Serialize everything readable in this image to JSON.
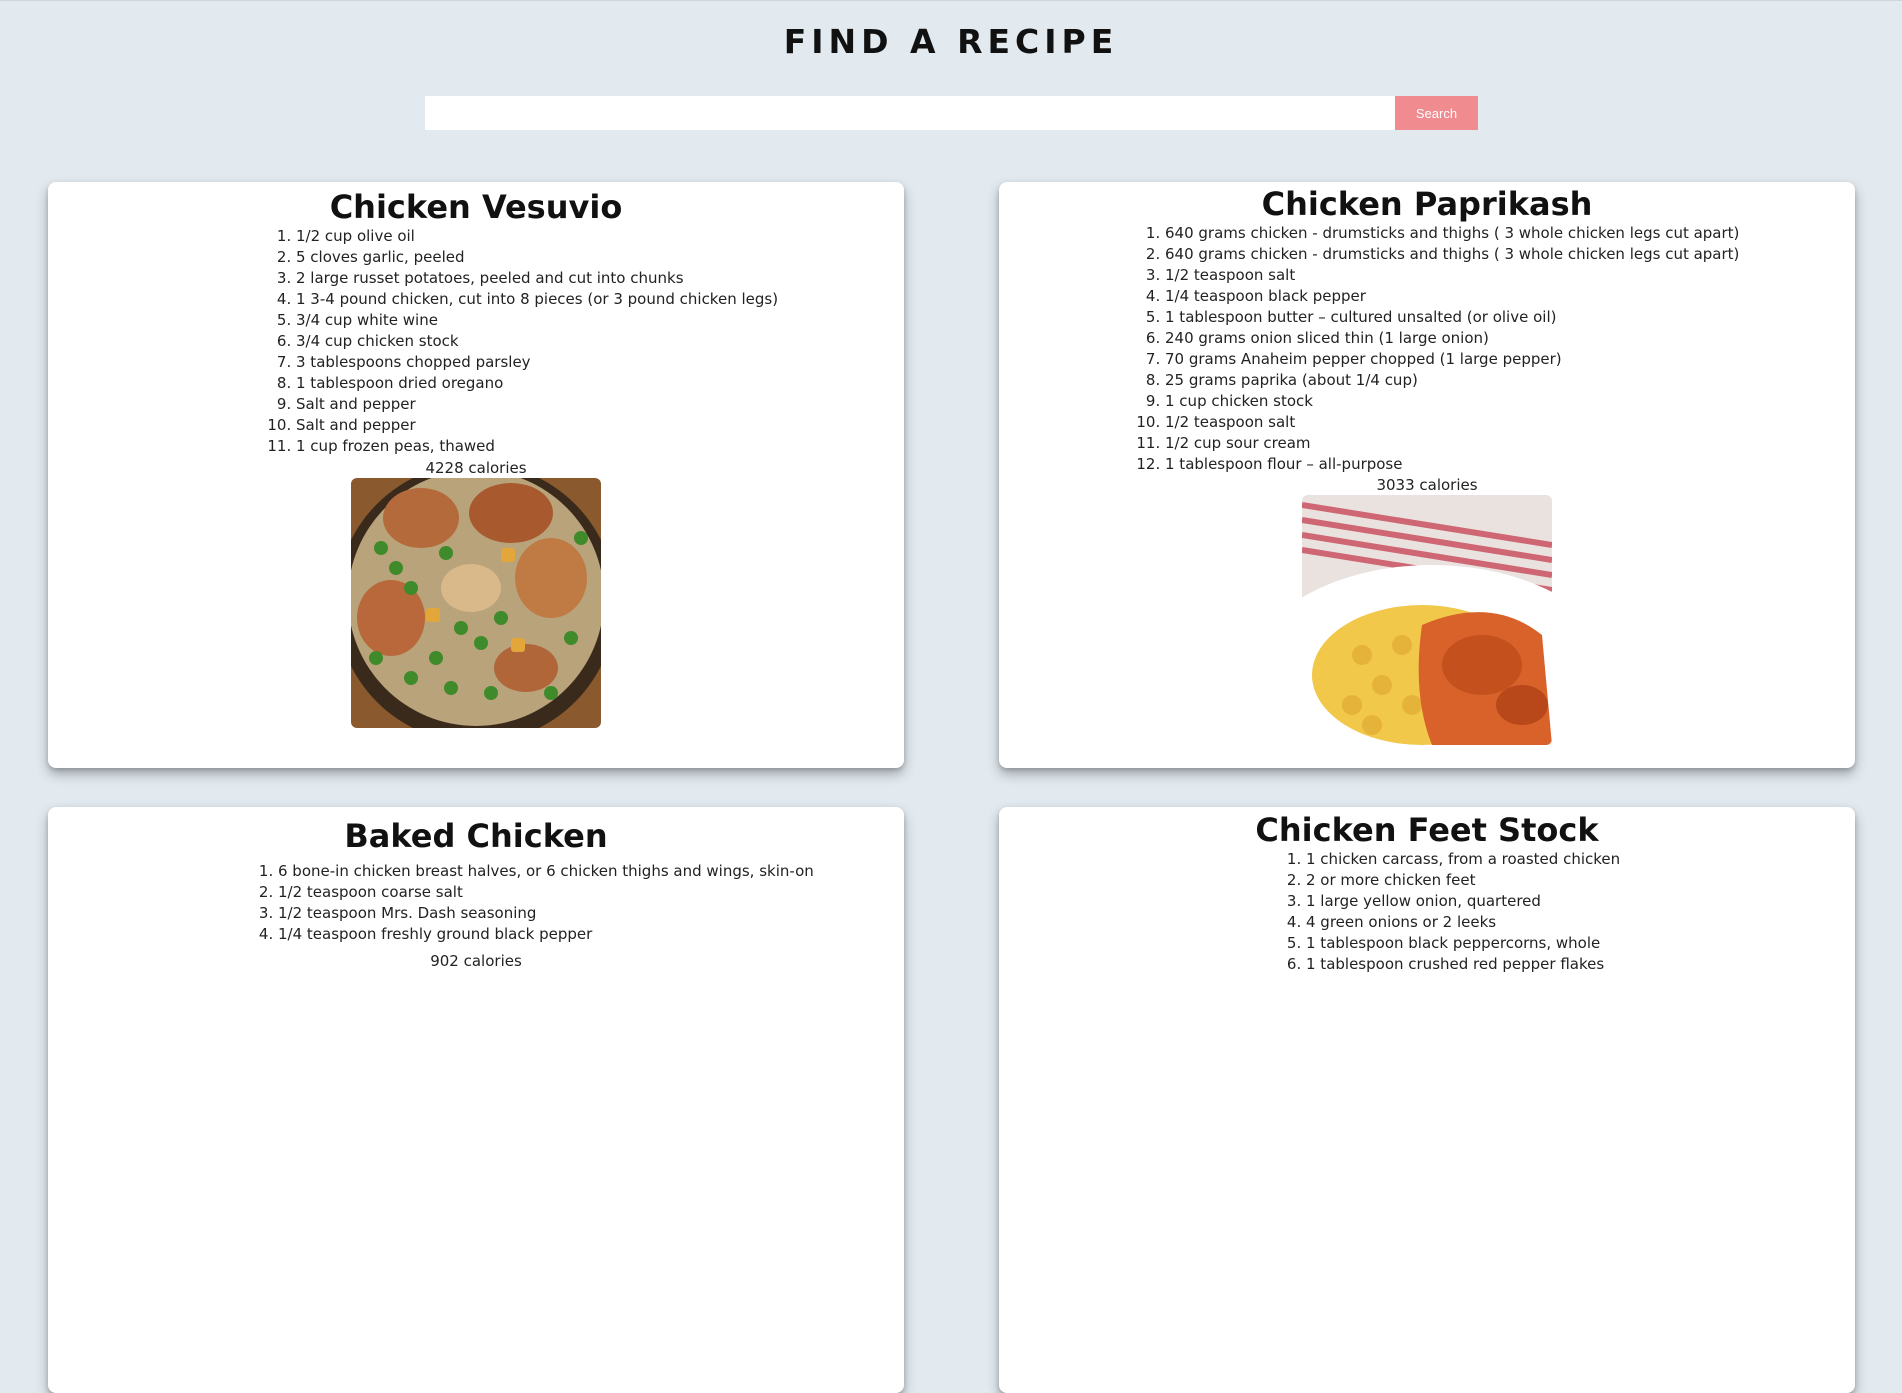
{
  "header": {
    "title": "FIND A RECIPE"
  },
  "search": {
    "placeholder": "",
    "value": "",
    "button_label": "Search"
  },
  "recipes": [
    {
      "title": "Chicken Vesuvio",
      "ingredients": [
        "1/2 cup olive oil",
        "5 cloves garlic, peeled",
        "2 large russet potatoes, peeled and cut into chunks",
        "1 3-4 pound chicken, cut into 8 pieces (or 3 pound chicken legs)",
        "3/4 cup white wine",
        "3/4 cup chicken stock",
        "3 tablespoons chopped parsley",
        "1 tablespoon dried oregano",
        "Salt and pepper",
        "Salt and pepper",
        "1 cup frozen peas, thawed"
      ],
      "calories": "4228 calories",
      "image": "chicken-vesuvio-photo"
    },
    {
      "title": "Chicken Paprikash",
      "ingredients": [
        "640 grams chicken - drumsticks and thighs ( 3 whole chicken legs cut apart)",
        "640 grams chicken - drumsticks and thighs ( 3 whole chicken legs cut apart)",
        "1/2 teaspoon salt",
        "1/4 teaspoon black pepper",
        "1 tablespoon butter – cultured unsalted (or olive oil)",
        "240 grams onion sliced thin (1 large onion)",
        "70 grams Anaheim pepper chopped (1 large pepper)",
        "25 grams paprika (about 1/4 cup)",
        "1 cup chicken stock",
        "1/2 teaspoon salt",
        "1/2 cup sour cream",
        "1 tablespoon flour – all-purpose"
      ],
      "calories": "3033 calories",
      "image": "chicken-paprikash-photo"
    },
    {
      "title": "Baked Chicken",
      "ingredients": [
        "6 bone-in chicken breast halves, or 6 chicken thighs and wings, skin-on",
        "1/2 teaspoon coarse salt",
        "1/2 teaspoon Mrs. Dash seasoning",
        "1/4 teaspoon freshly ground black pepper"
      ],
      "calories": "902 calories",
      "image": "baked-chicken-photo"
    },
    {
      "title": "Chicken Feet Stock",
      "ingredients": [
        "1 chicken carcass, from a roasted chicken",
        "2 or more chicken feet",
        "1 large yellow onion, quartered",
        "4 green onions or 2 leeks",
        "1 tablespoon black peppercorns, whole",
        "1 tablespoon crushed red pepper flakes"
      ],
      "calories": "",
      "image": "chicken-feet-stock-photo"
    }
  ]
}
